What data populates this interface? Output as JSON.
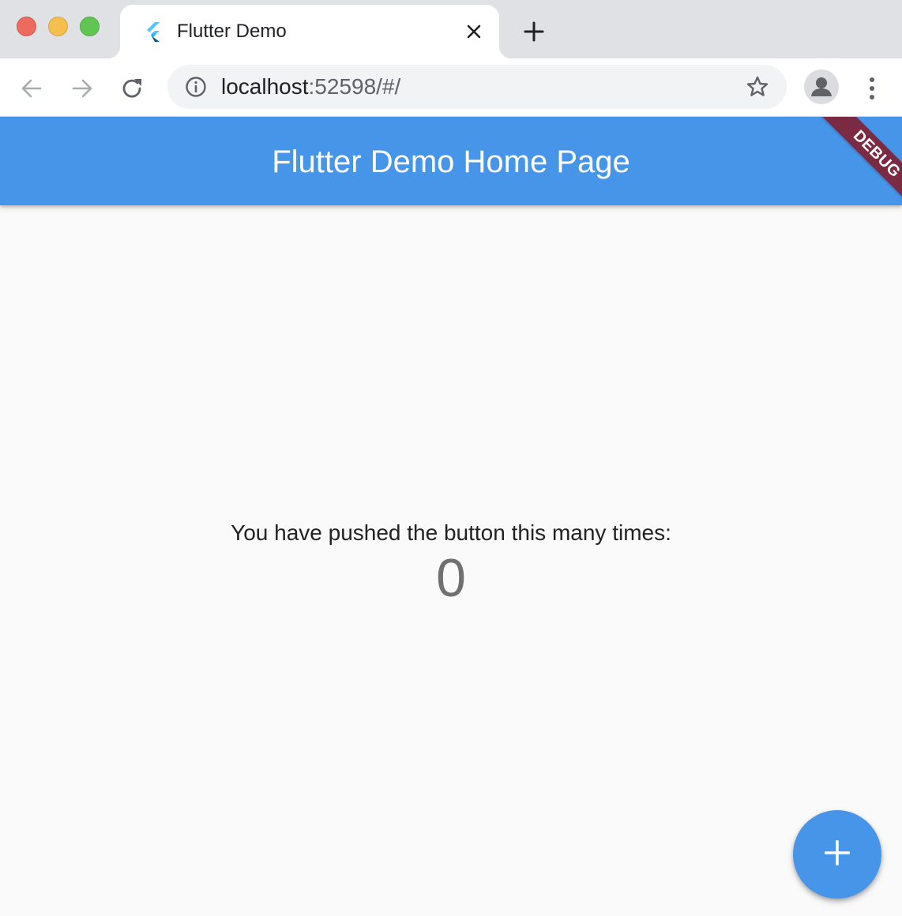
{
  "browser": {
    "tab": {
      "title": "Flutter Demo",
      "favicon": "flutter-logo-icon",
      "close_icon": "close-icon"
    },
    "new_tab_icon": "plus-icon",
    "toolbar": {
      "back_icon": "arrow-left-icon",
      "forward_icon": "arrow-right-icon",
      "reload_icon": "reload-icon",
      "site_info_icon": "info-icon",
      "url_host": "localhost",
      "url_rest": ":52598/#/",
      "bookmark_icon": "star-icon",
      "profile_icon": "person-icon",
      "menu_icon": "more-vert-icon"
    }
  },
  "app": {
    "appbar_title": "Flutter Demo Home Page",
    "debug_banner": "DEBUG",
    "counter_label": "You have pushed the button this many times:",
    "counter_value": "0",
    "fab_icon": "add-icon"
  },
  "colors": {
    "primary": "#4795e9",
    "debug_banner": "#7b2a43",
    "background": "#fafafa"
  }
}
